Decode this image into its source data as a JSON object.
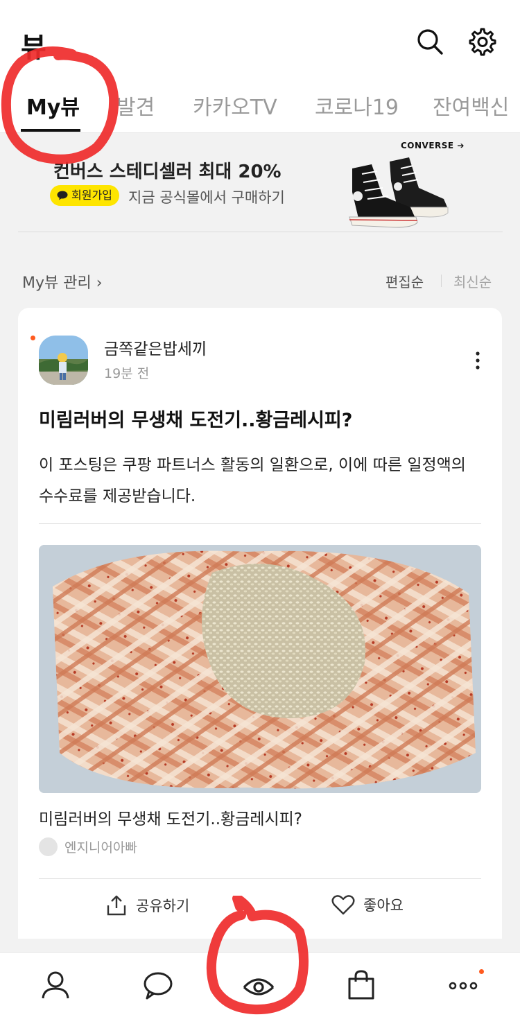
{
  "header": {
    "title": "뷰"
  },
  "tabs": [
    {
      "label": "My뷰",
      "active": true
    },
    {
      "label": "발견",
      "active": false
    },
    {
      "label": "카카오TV",
      "active": false
    },
    {
      "label": "코로나19",
      "active": false
    },
    {
      "label": "잔여백신",
      "active": false
    }
  ],
  "ad": {
    "title": "컨버스 스테디셀러 최대 20%",
    "badge": "회원가입",
    "subtitle": "지금 공식몰에서 구매하기",
    "brand": "CONVERSE"
  },
  "manage": {
    "label": "My뷰 관리 ›",
    "sort_edit": "편집순",
    "sort_recent": "최신순"
  },
  "post": {
    "author": "금쪽같은밥세끼",
    "time": "19분 전",
    "title": "미림러버의 무생채 도전기..황금레시피?",
    "desc": "이 포스팅은 쿠팡 파트너스 활동의 일환으로, 이에 따른 일정액의 수수료를 제공받습니다.",
    "link_title": "미림러버의 무생채 도전기..황금레시피?",
    "source": "엔지니어아빠",
    "share_label": "공유하기",
    "like_label": "좋아요"
  },
  "icons": {
    "search": "search-icon",
    "settings": "gear-icon",
    "more": "more-vertical-icon",
    "share": "share-icon",
    "like": "heart-icon",
    "nav": [
      "person-icon",
      "chat-bubble-icon",
      "view-eye-icon",
      "shopping-bag-icon",
      "more-horizontal-icon"
    ]
  },
  "colors": {
    "accent_dot": "#ff5a1f",
    "badge_yellow": "#fee500",
    "annotation_red": "#ef2b2b"
  }
}
